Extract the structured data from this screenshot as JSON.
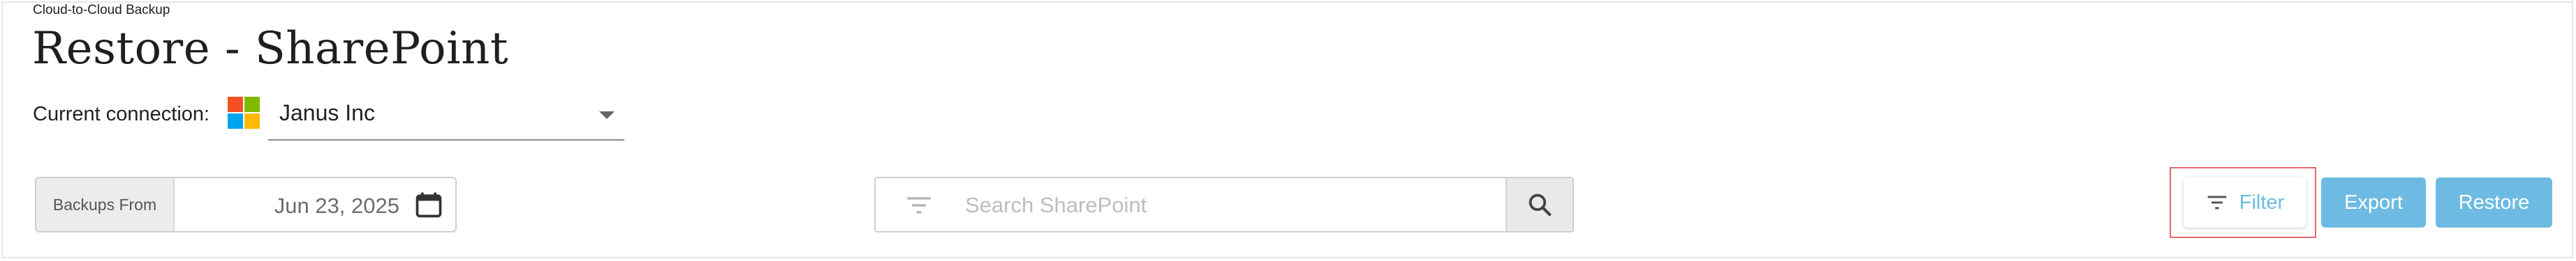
{
  "breadcrumb": "Cloud-to-Cloud Backup",
  "page_title": "Restore - SharePoint",
  "connection": {
    "label": "Current connection:",
    "value": "Janus Inc",
    "logo_colors": [
      "#f25022",
      "#7fba00",
      "#00a4ef",
      "#ffb900"
    ]
  },
  "backups_from": {
    "label": "Backups From",
    "date": "Jun 23, 2025",
    "icon": "calendar-icon"
  },
  "search": {
    "placeholder": "Search SharePoint",
    "filter_icon": "filter-lines-icon",
    "button_icon": "magnifier-icon"
  },
  "actions": {
    "filter_label": "Filter",
    "export_label": "Export",
    "restore_label": "Restore"
  },
  "colors": {
    "accent": "#6dbbe2",
    "highlight": "#e06a6a"
  }
}
